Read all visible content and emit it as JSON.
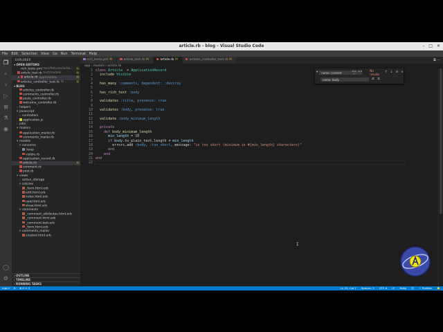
{
  "window": {
    "title": "article.rb - blog - Visual Studio Code",
    "buttons": [
      "–",
      "□",
      "✕"
    ]
  },
  "menu": [
    "File",
    "Edit",
    "Selection",
    "View",
    "Go",
    "Run",
    "Terminal",
    "Help"
  ],
  "sidebar": {
    "title": "EXPLORER",
    "open_editors_label": "OPEN EDITORS",
    "open_editors": [
      {
        "name": "rich_texts.yml",
        "path": "test/fixtures/actio...",
        "marker": "M",
        "icon": "yml"
      },
      {
        "name": "article_test.rb",
        "path": "test/models",
        "marker": "M",
        "icon": "rb"
      },
      {
        "name": "article.rb",
        "path": "app/models",
        "marker": "M",
        "icon": "rb",
        "active": true,
        "close": "×"
      },
      {
        "name": "articles_controller_test.rb",
        "path": "te...",
        "marker": "M",
        "icon": "rb"
      }
    ],
    "project_label": "BLOG",
    "tree": [
      {
        "name": "articles_controller.rb",
        "depth": 1,
        "icon": "rb"
      },
      {
        "name": "comments_controller.rb",
        "depth": 1,
        "icon": "rb"
      },
      {
        "name": "posts_controller.rb",
        "depth": 1,
        "icon": "rb"
      },
      {
        "name": "welcome_controller.rb",
        "depth": 1,
        "icon": "rb"
      },
      {
        "name": "helpers",
        "depth": 0,
        "folder": true,
        "open": false
      },
      {
        "name": "javascript",
        "depth": 0,
        "folder": true,
        "open": true
      },
      {
        "name": "controllers",
        "depth": 1,
        "folder": true,
        "open": false
      },
      {
        "name": "application.js",
        "depth": 1,
        "icon": "js"
      },
      {
        "name": "jobs",
        "depth": 0,
        "folder": true,
        "open": false
      },
      {
        "name": "mailers",
        "depth": 0,
        "folder": true,
        "open": true
      },
      {
        "name": "application_mailer.rb",
        "depth": 1,
        "icon": "rb"
      },
      {
        "name": "comments_mailer.rb",
        "depth": 1,
        "icon": "rb"
      },
      {
        "name": "models",
        "depth": 0,
        "folder": true,
        "open": true
      },
      {
        "name": "concerns",
        "depth": 1,
        "folder": true,
        "open": true
      },
      {
        "name": ".keep",
        "depth": 2,
        "icon": "gen"
      },
      {
        "name": "visible.rb",
        "depth": 2,
        "icon": "rb"
      },
      {
        "name": "application_record.rb",
        "depth": 1,
        "icon": "rb"
      },
      {
        "name": "article.rb",
        "depth": 1,
        "icon": "rb",
        "active": true,
        "marker": "M"
      },
      {
        "name": "comment.rb",
        "depth": 1,
        "icon": "rb"
      },
      {
        "name": "post.rb",
        "depth": 1,
        "icon": "rb"
      },
      {
        "name": "views",
        "depth": 0,
        "folder": true,
        "open": true
      },
      {
        "name": "active_storage",
        "depth": 1,
        "folder": true,
        "open": false
      },
      {
        "name": "articles",
        "depth": 1,
        "folder": true,
        "open": true
      },
      {
        "name": "_form.html.erb",
        "depth": 2,
        "icon": "erb"
      },
      {
        "name": "edit.html.erb",
        "depth": 2,
        "icon": "erb"
      },
      {
        "name": "index.html.erb",
        "depth": 2,
        "icon": "erb"
      },
      {
        "name": "new.html.erb",
        "depth": 2,
        "icon": "erb"
      },
      {
        "name": "show.html.erb",
        "depth": 2,
        "icon": "erb"
      },
      {
        "name": "comments",
        "depth": 1,
        "folder": true,
        "open": true
      },
      {
        "name": "_comment_attributes.html.erb",
        "depth": 2,
        "icon": "erb"
      },
      {
        "name": "_comment.html.erb",
        "depth": 2,
        "icon": "erb"
      },
      {
        "name": "_comment.text.erb",
        "depth": 2,
        "icon": "erb"
      },
      {
        "name": "_form.html.erb",
        "depth": 2,
        "icon": "erb"
      },
      {
        "name": "comments_mailer",
        "depth": 1,
        "folder": true,
        "open": true
      },
      {
        "name": "created.html.erb",
        "depth": 2,
        "icon": "erb"
      }
    ],
    "outline_label": "OUTLINE",
    "timeline_label": "TIMELINE",
    "running_tasks_label": "RUNNING TASKS"
  },
  "tabs": [
    {
      "label": "rich_texts.yml",
      "marker": "M",
      "icon": "yml"
    },
    {
      "label": "article_test.rb",
      "marker": "M",
      "icon": "rb"
    },
    {
      "label": "article.rb",
      "marker": "M",
      "icon": "rb",
      "active": true
    },
    {
      "label": "articles_controller_test.rb",
      "marker": "M",
      "icon": "rb"
    }
  ],
  "tab_actions": "⧉ ···",
  "breadcrumb": [
    "app",
    "models",
    "article.rb"
  ],
  "line_numbers": [
    "1",
    "2",
    "3",
    "4",
    "5",
    "6",
    "7",
    "8",
    "9",
    "10",
    "11",
    "12",
    "13",
    "14",
    "15",
    "16",
    "17",
    "18",
    "19",
    "20",
    "21",
    "22"
  ],
  "code_lines": [
    [
      [
        "kw",
        "class "
      ],
      [
        "cls",
        "Article"
      ],
      [
        "",
        "  < "
      ],
      [
        "cls",
        "ApplicationRecord"
      ]
    ],
    [
      [
        "",
        "  "
      ],
      [
        "mth",
        "include "
      ],
      [
        "cls",
        "Visible"
      ]
    ],
    [],
    [
      [
        "",
        "  "
      ],
      [
        "mth",
        "has_many "
      ],
      [
        "sym",
        ":comments"
      ],
      [
        "",
        ", "
      ],
      [
        "sym",
        "dependent: :destroy"
      ]
    ],
    [],
    [
      [
        "",
        "  "
      ],
      [
        "mth",
        "has_rich_text "
      ],
      [
        "sym",
        ":body"
      ]
    ],
    [],
    [
      [
        "",
        "  "
      ],
      [
        "mth",
        "validates "
      ],
      [
        "sym",
        ":title"
      ],
      [
        "",
        ", "
      ],
      [
        "sym",
        "presence: true"
      ]
    ],
    [],
    [
      [
        "",
        "  "
      ],
      [
        "mth",
        "validates "
      ],
      [
        "sym",
        ":body"
      ],
      [
        "",
        ", "
      ],
      [
        "sym",
        "presence: true"
      ]
    ],
    [],
    [
      [
        "",
        "  "
      ],
      [
        "mth",
        "validate "
      ],
      [
        "sym",
        ":body_minimum_length"
      ]
    ],
    [],
    [
      [
        "",
        "  "
      ],
      [
        "kw",
        "private"
      ]
    ],
    [
      [
        "",
        "    "
      ],
      [
        "kw",
        "def "
      ],
      [
        "mth",
        "body_minimum_length"
      ]
    ],
    [
      [
        "",
        "      "
      ],
      [
        "var",
        "min_length"
      ],
      [
        "",
        " = "
      ],
      [
        "num",
        "10"
      ]
    ],
    [
      [
        "",
        "      "
      ],
      [
        "kw",
        "if "
      ],
      [
        "var",
        "body"
      ],
      [
        "",
        ".to_plain_text.length "
      ],
      [
        "",
        "≠ "
      ],
      [
        "var",
        "min_length"
      ]
    ],
    [
      [
        "",
        "        errors.add "
      ],
      [
        "sym",
        ":body"
      ],
      [
        "",
        ", "
      ],
      [
        "sym",
        ":too_short"
      ],
      [
        "",
        ", message: "
      ],
      [
        "str",
        "\"is too short (minimum is #{min_length} characters)\""
      ]
    ],
    [
      [
        "",
        "      "
      ],
      [
        "kw",
        "end"
      ]
    ],
    [
      [
        "",
        "    "
      ],
      [
        "kw",
        "end"
      ]
    ],
    [
      [
        "kw",
        "end"
      ]
    ],
    []
  ],
  "find": {
    "find_value": "name: content",
    "options": "Aa ab .*",
    "no_results": "No results",
    "replace_value": "name: body",
    "nav_buttons": [
      "↑",
      "↓",
      "≡",
      "×"
    ],
    "replace_buttons": [
      "⇄",
      "⇉"
    ]
  },
  "status": {
    "branch": "main*",
    "sync": "⟳",
    "errors": "⊗ 0 ⚠ 0",
    "cursor": "Ln 22, Col 1",
    "spaces": "Spaces: 2",
    "encoding": "UTF-8",
    "eol": "LF",
    "language": "Ruby",
    "feedback": "☺",
    "prettier": "✓ Prettier",
    "bell": "🔔"
  },
  "colors": {
    "accent": "#007acc",
    "keyword": "#c586c0",
    "class": "#4ec9b0",
    "symbol": "#569cd6",
    "string": "#ce9178"
  }
}
